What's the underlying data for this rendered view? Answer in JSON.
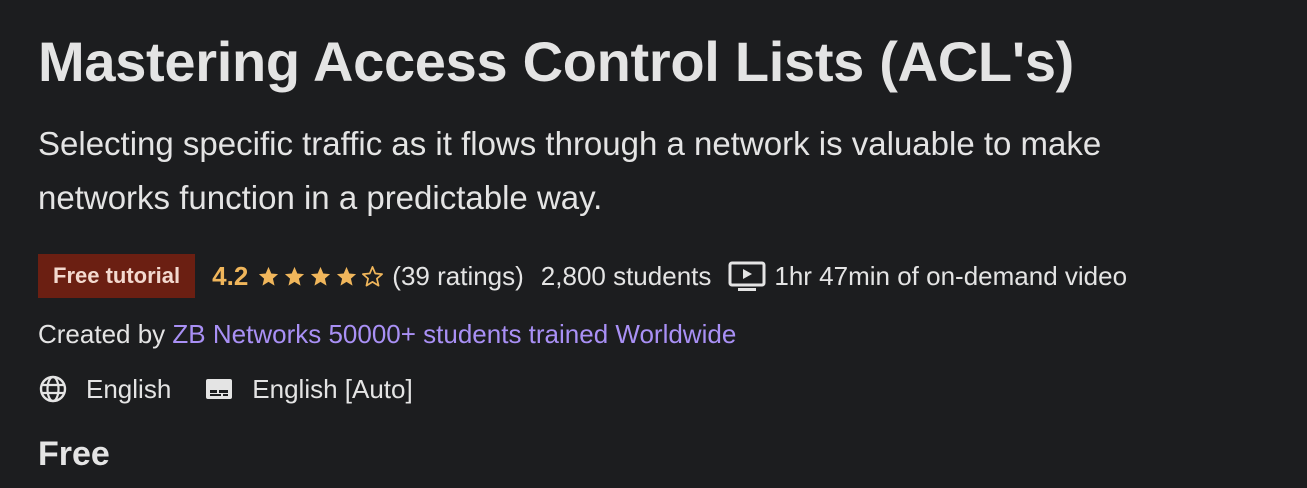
{
  "course": {
    "title": "Mastering Access Control Lists (ACL's)",
    "subtitle": "Selecting specific traffic as it flows through a network is valuable to make networks function in a predictable way.",
    "badge": "Free tutorial",
    "rating": "4.2",
    "rating_value": 4.2,
    "rating_max": 5,
    "ratings_count": "(39 ratings)",
    "students": "2,800 students",
    "video_length": "1hr 47min of on-demand video",
    "created_by_prefix": "Created by",
    "instructor": "ZB Networks 50000+ students trained Worldwide",
    "language": "English",
    "captions": "English [Auto]",
    "price": "Free"
  },
  "colors": {
    "background": "#1c1d1f",
    "text": "#e4e4e4",
    "badge_bg": "#6b1f12",
    "rating": "#f0b65b",
    "link": "#a990f5"
  },
  "icons": {
    "star": "star-icon",
    "video": "video-icon",
    "language": "globe-icon",
    "captions": "closed-captions-icon"
  }
}
